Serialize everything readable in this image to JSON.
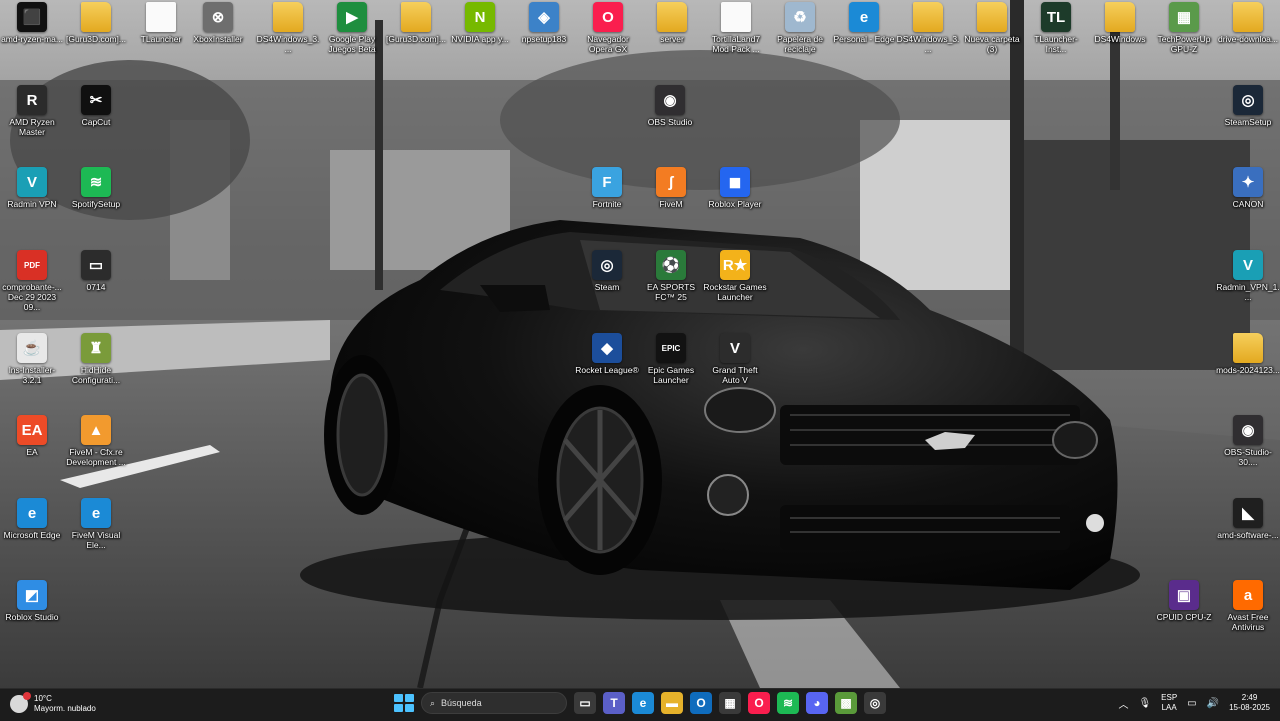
{
  "desktop": {
    "icons": [
      {
        "label": "amd-ryzen-ma...",
        "glyph": "⬛",
        "color": "#111111",
        "kind": "app"
      },
      {
        "label": "[Guru3D.com]...",
        "glyph": "",
        "color": "#e6b22b",
        "kind": "folder"
      },
      {
        "label": "TLauncher",
        "glyph": "",
        "color": "#fafafa",
        "kind": "doc"
      },
      {
        "label": "XboxInstaller",
        "glyph": "⊗",
        "color": "#6e6e6e",
        "kind": "app"
      },
      {
        "label": "DS4Windows_3....",
        "glyph": "",
        "color": "#e6b22b",
        "kind": "folder"
      },
      {
        "label": "Google Play Juegos Beta",
        "glyph": "▶",
        "color": "#1e8e3e",
        "kind": "app"
      },
      {
        "label": "[Guru3D.com]...",
        "glyph": "",
        "color": "#e6b22b",
        "kind": "folder"
      },
      {
        "label": "NVIDIA app y...",
        "glyph": "N",
        "color": "#76b900",
        "kind": "app"
      },
      {
        "label": "npsetup183",
        "glyph": "◈",
        "color": "#3c82c8",
        "kind": "app"
      },
      {
        "label": "Navegador Opera GX",
        "glyph": "O",
        "color": "#fa1e4e",
        "kind": "app"
      },
      {
        "label": "server",
        "glyph": "",
        "color": "#e6b22b",
        "kind": "folder"
      },
      {
        "label": "TortillaLand7 Mod Pack ...",
        "glyph": "",
        "color": "#fafafa",
        "kind": "doc"
      },
      {
        "label": "Papelera de reciclaje",
        "glyph": "♻",
        "color": "#9fb8cf",
        "kind": "app"
      },
      {
        "label": "Personal - Edge",
        "glyph": "e",
        "color": "#1b8ad6",
        "kind": "app"
      },
      {
        "label": "DS4Windows_3....",
        "glyph": "",
        "color": "#e6b22b",
        "kind": "folder"
      },
      {
        "label": "Nueva carpeta (3)",
        "glyph": "",
        "color": "#e6b22b",
        "kind": "folder"
      },
      {
        "label": "TLauncher-Inst...",
        "glyph": "TL",
        "color": "#1d3b2a",
        "kind": "app"
      },
      {
        "label": "DS4Windows",
        "glyph": "",
        "color": "#e6b22b",
        "kind": "folder"
      },
      {
        "label": "TechPowerUp GPU-Z",
        "glyph": "▦",
        "color": "#5a9a4a",
        "kind": "app"
      },
      {
        "label": "drive-downloa...",
        "glyph": "",
        "color": "#e6b22b",
        "kind": "folder"
      },
      {
        "label": "AMD Ryzen Master",
        "glyph": "R",
        "color": "#2b2b2b",
        "kind": "app"
      },
      {
        "label": "CapCut",
        "glyph": "✂",
        "color": "#101010",
        "kind": "app"
      },
      {
        "label": "OBS Studio",
        "glyph": "◉",
        "color": "#302e31",
        "kind": "app"
      },
      {
        "label": "SteamSetup",
        "glyph": "◎",
        "color": "#1b2838",
        "kind": "app"
      },
      {
        "label": "Radmin VPN",
        "glyph": "V",
        "color": "#1a9fb5",
        "kind": "app"
      },
      {
        "label": "SpotifySetup",
        "glyph": "≋",
        "color": "#1db954",
        "kind": "app"
      },
      {
        "label": "Fortnite",
        "glyph": "F",
        "color": "#3aa3e0",
        "kind": "app"
      },
      {
        "label": "FiveM",
        "glyph": "ʃ",
        "color": "#f37c22",
        "kind": "app"
      },
      {
        "label": "Roblox Player",
        "glyph": "◼",
        "color": "#2466f0",
        "kind": "app"
      },
      {
        "label": "CANON",
        "glyph": "✦",
        "color": "#3a6fbf",
        "kind": "app"
      },
      {
        "label": "comprobante-... Dec 29 2023 09...",
        "glyph": "PDF",
        "color": "#d93025",
        "kind": "app"
      },
      {
        "label": "0714",
        "glyph": "▭",
        "color": "#2c2c2c",
        "kind": "app"
      },
      {
        "label": "Steam",
        "glyph": "◎",
        "color": "#1b2838",
        "kind": "app"
      },
      {
        "label": "EA SPORTS FC™ 25",
        "glyph": "⚽",
        "color": "#2a7a3a",
        "kind": "app"
      },
      {
        "label": "Rockstar Games Launcher",
        "glyph": "R★",
        "color": "#f3b21a",
        "kind": "app"
      },
      {
        "label": "Radmin_VPN_1....",
        "glyph": "V",
        "color": "#1a9fb5",
        "kind": "app"
      },
      {
        "label": "lns-Installer-3.2.1",
        "glyph": "☕",
        "color": "#e8e8e8",
        "kind": "app"
      },
      {
        "label": "HidHide Configurati...",
        "glyph": "♜",
        "color": "#7a9b3a",
        "kind": "app"
      },
      {
        "label": "Rocket League®",
        "glyph": "◆",
        "color": "#1c4e9b",
        "kind": "app"
      },
      {
        "label": "Epic Games Launcher",
        "glyph": "EPIC",
        "color": "#121212",
        "kind": "app"
      },
      {
        "label": "Grand Theft Auto V",
        "glyph": "V",
        "color": "#2c2c2c",
        "kind": "app"
      },
      {
        "label": "mods-2024123...",
        "glyph": "",
        "color": "#e6b22b",
        "kind": "folder"
      },
      {
        "label": "EA",
        "glyph": "EA",
        "color": "#ed4b27",
        "kind": "app"
      },
      {
        "label": "FiveM - Cfx.re Development ...",
        "glyph": "▲",
        "color": "#f29a2e",
        "kind": "app"
      },
      {
        "label": "OBS-Studio-30....",
        "glyph": "◉",
        "color": "#302e31",
        "kind": "app"
      },
      {
        "label": "Microsoft Edge",
        "glyph": "e",
        "color": "#1b8ad6",
        "kind": "app"
      },
      {
        "label": "FiveM Visual Ele...",
        "glyph": "e",
        "color": "#1b8ad6",
        "kind": "app"
      },
      {
        "label": "amd-software-...",
        "glyph": "◣",
        "color": "#1f1f1f",
        "kind": "app"
      },
      {
        "label": "Roblox Studio",
        "glyph": "◩",
        "color": "#2f8de4",
        "kind": "app"
      },
      {
        "label": "CPUID CPU-Z",
        "glyph": "▣",
        "color": "#5a2c8c",
        "kind": "app"
      },
      {
        "label": "Avast Free Antivirus",
        "glyph": "a",
        "color": "#ff6a00",
        "kind": "app"
      }
    ]
  },
  "taskbar": {
    "weather_temp": "10°C",
    "weather_desc": "Mayorm. nublado",
    "search_placeholder": "Búsqueda",
    "apps": [
      {
        "name": "task-view",
        "glyph": "▭",
        "color": "#3a3a3a"
      },
      {
        "name": "teams",
        "glyph": "T",
        "color": "#5b5fc7"
      },
      {
        "name": "edge",
        "glyph": "e",
        "color": "#1b8ad6"
      },
      {
        "name": "file-explorer",
        "glyph": "▬",
        "color": "#e6b22b"
      },
      {
        "name": "outlook",
        "glyph": "O",
        "color": "#0f6cbd"
      },
      {
        "name": "microsoft-store",
        "glyph": "▦",
        "color": "#3a3a3a"
      },
      {
        "name": "opera-gx",
        "glyph": "O",
        "color": "#fa1e4e"
      },
      {
        "name": "spotify",
        "glyph": "≋",
        "color": "#1db954"
      },
      {
        "name": "discord",
        "glyph": "◕",
        "color": "#5865f2"
      },
      {
        "name": "minecraft",
        "glyph": "▩",
        "color": "#5a9a3a"
      },
      {
        "name": "steam-overlay",
        "glyph": "◎",
        "color": "#3a3a3a"
      }
    ],
    "lang_line1": "ESP",
    "lang_line2": "LAA",
    "time": "2:49",
    "date": "15-08-2025"
  }
}
